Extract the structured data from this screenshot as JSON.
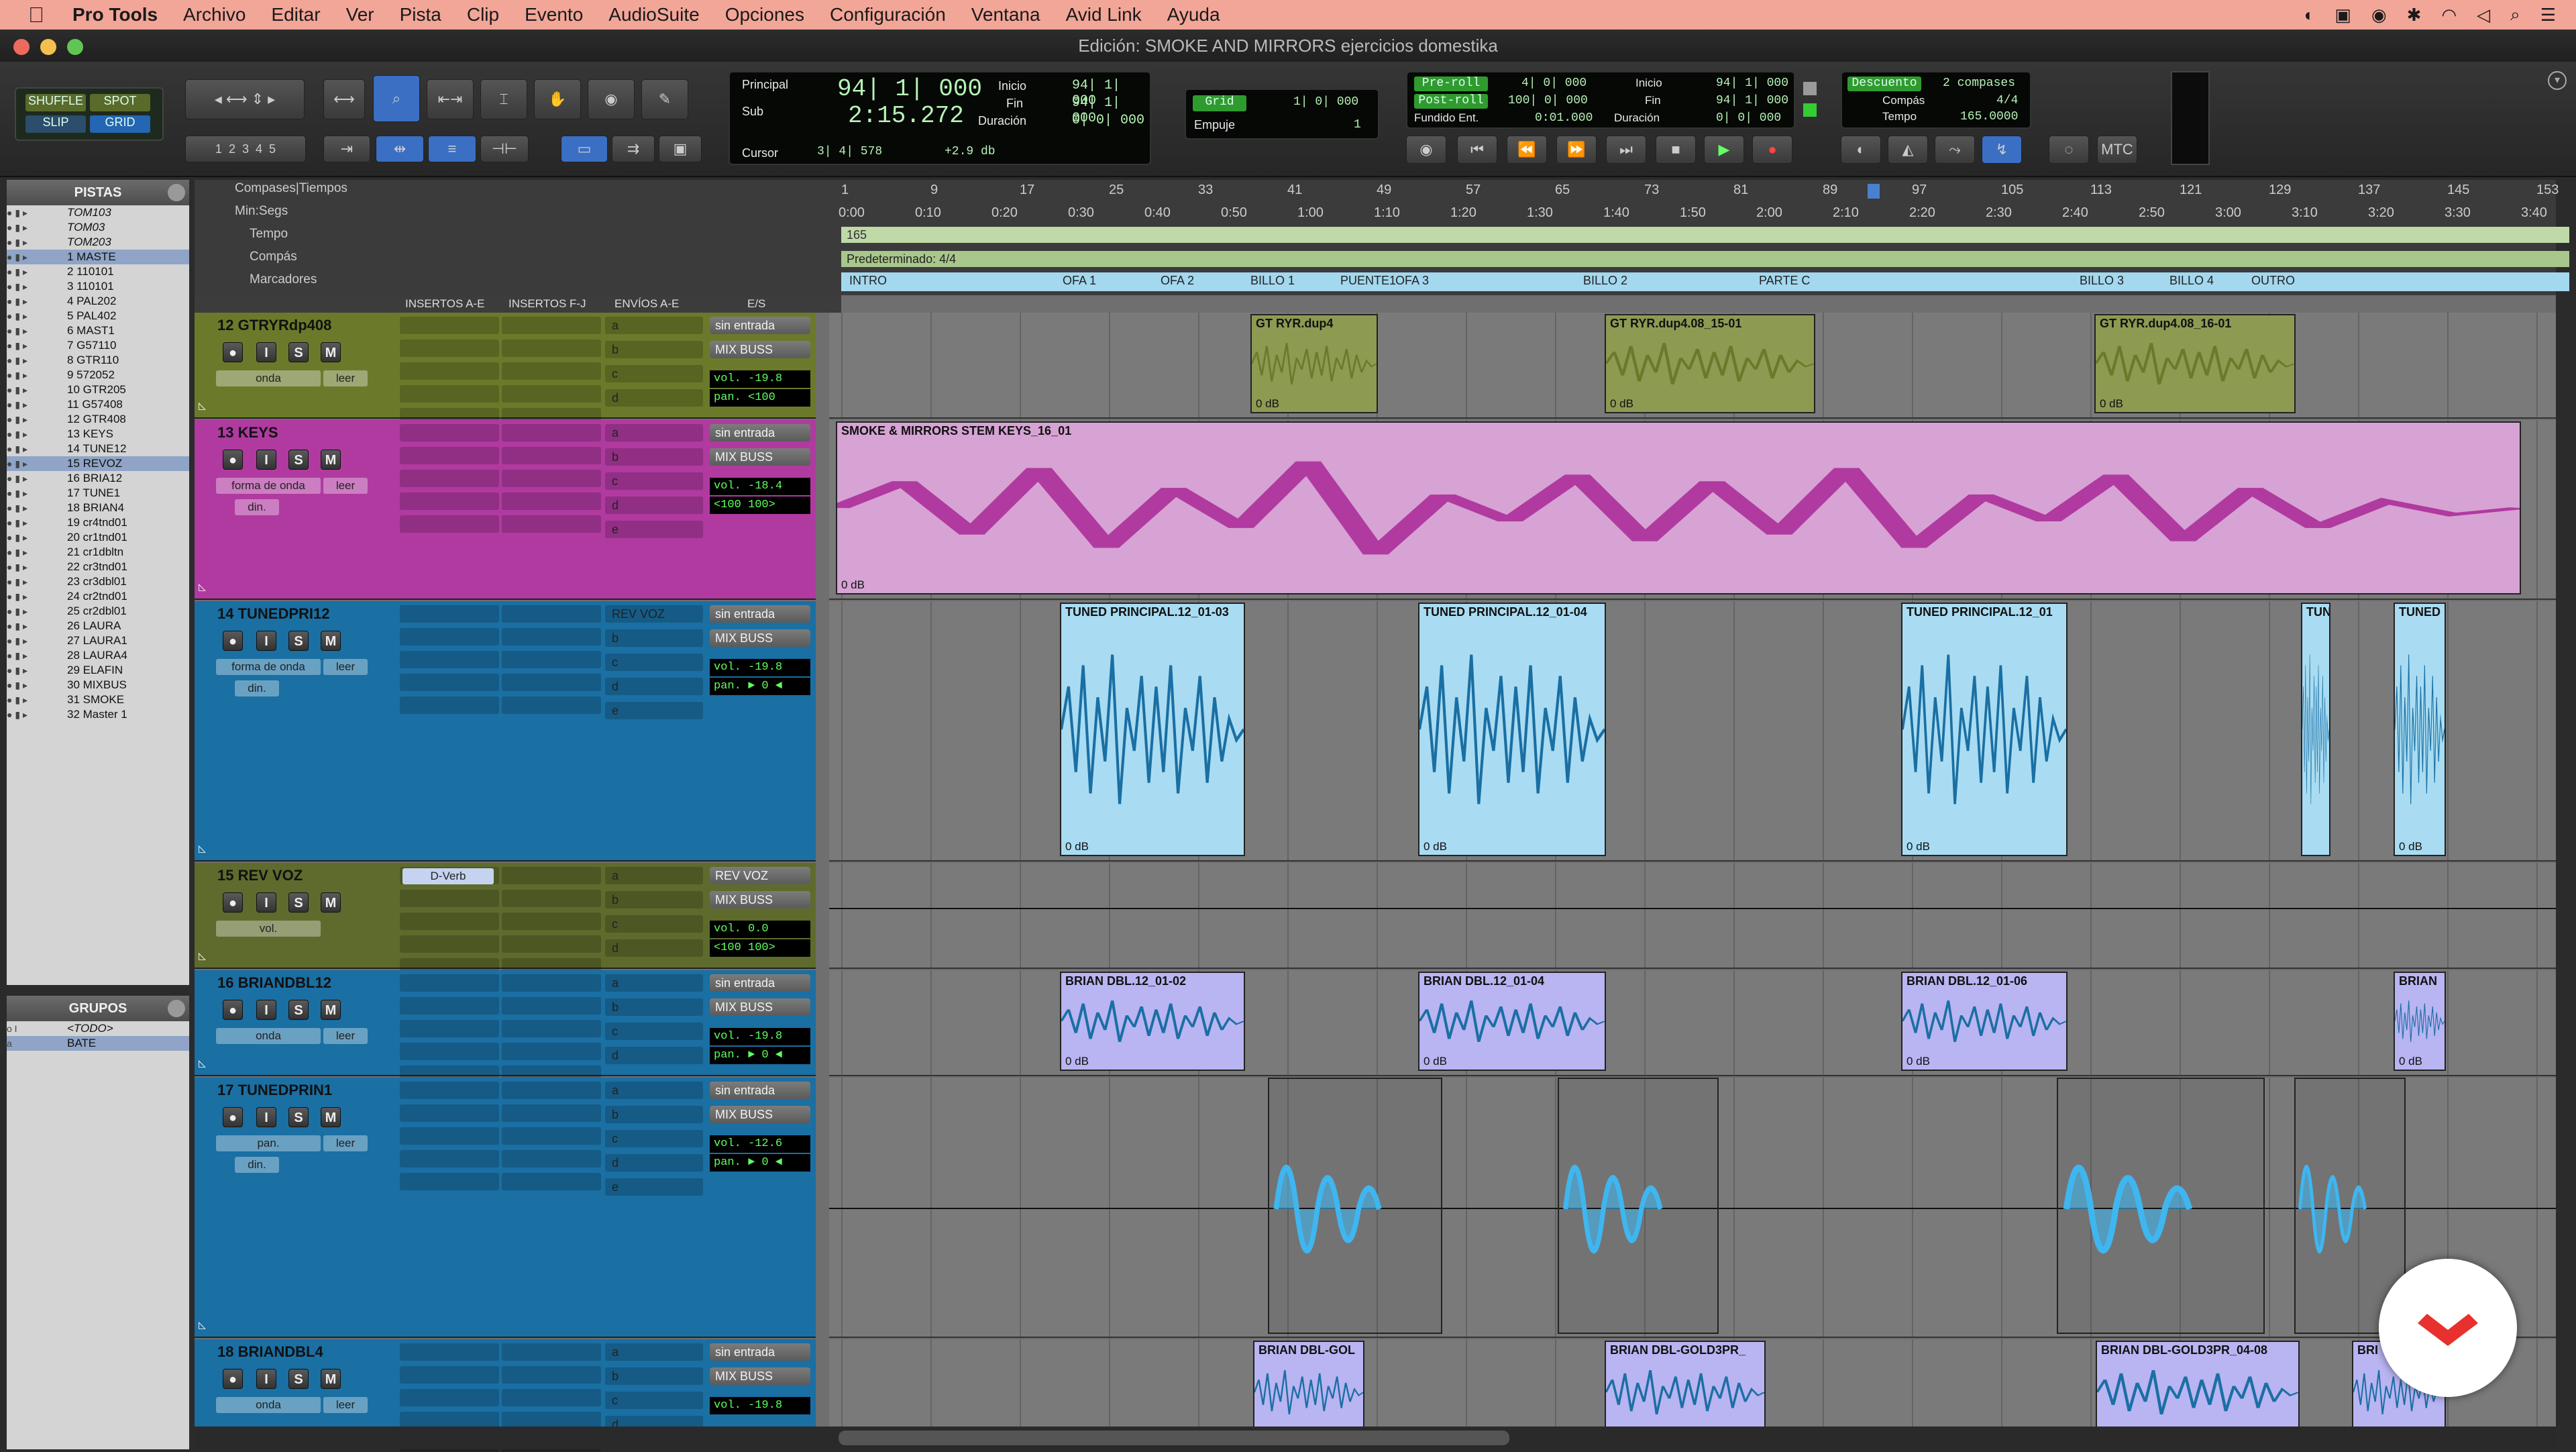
{
  "menubar": {
    "apple": "",
    "items": [
      "Pro Tools",
      "Archivo",
      "Editar",
      "Ver",
      "Pista",
      "Clip",
      "Evento",
      "AudioSuite",
      "Opciones",
      "Configuración",
      "Ventana",
      "Avid Link",
      "Ayuda"
    ]
  },
  "window": {
    "title": "Edición: SMOKE AND MIRRORS ejercicios domestika"
  },
  "toolbar": {
    "modes": {
      "shuffle": "SHUFFLE",
      "spot": "SPOT",
      "slip": "SLIP",
      "grid": "GRID"
    },
    "zoom_presets": [
      "1",
      "2",
      "3",
      "4",
      "5"
    ],
    "counter": {
      "principal_label": "Principal",
      "principal": "94| 1| 000",
      "sub_label": "Sub",
      "sub": "2:15.272",
      "cursor_label": "Cursor",
      "cursor": "3| 4| 578",
      "cursor_extra": "+2.9 db",
      "inicio_label": "Inicio",
      "inicio": "94| 1| 000",
      "fin_label": "Fin",
      "fin": "94| 1| 000",
      "duracion_label": "Duración",
      "duracion": "0| 0| 000"
    },
    "grid": {
      "label": "Grid",
      "value": "1| 0| 000",
      "nudge_label": "Empuje",
      "nudge": "1"
    },
    "transport": {
      "preroll_label": "Pre-roll",
      "preroll": "4| 0| 000",
      "postroll_label": "Post-roll",
      "postroll": "100| 0| 000",
      "fade_label": "Fundido Ent.",
      "fade": "0:01.000",
      "inicio_label": "Inicio",
      "inicio": "94| 1| 000",
      "fin_label": "Fin",
      "fin": "94| 1| 000",
      "duracion_label": "Duración",
      "duracion": "0| 0| 000"
    },
    "countoff": {
      "descuento": "Descuento",
      "compases": "2 compases",
      "compas_label": "Compás",
      "compas": "4/4",
      "tempo_label": "Tempo",
      "tempo": "165.0000"
    },
    "mtc": "MTC"
  },
  "tracks_panel": {
    "title": "PISTAS",
    "items": [
      {
        "label": "TOM103",
        "italic": true
      },
      {
        "label": "TOM03",
        "italic": true
      },
      {
        "label": "TOM203",
        "italic": true
      },
      {
        "label": "1  MASTE",
        "sel": true
      },
      {
        "label": "2  110101"
      },
      {
        "label": "3  110101"
      },
      {
        "label": "4  PAL202"
      },
      {
        "label": "5  PAL402"
      },
      {
        "label": "6  MAST1"
      },
      {
        "label": "7  G57110"
      },
      {
        "label": "8  GTR110"
      },
      {
        "label": "9  572052"
      },
      {
        "label": "10 GTR205"
      },
      {
        "label": "11 G57408"
      },
      {
        "label": "12 GTR408"
      },
      {
        "label": "13 KEYS"
      },
      {
        "label": "14 TUNE12"
      },
      {
        "label": "15 REVOZ",
        "sel": true
      },
      {
        "label": "16 BRIA12"
      },
      {
        "label": "17 TUNE1"
      },
      {
        "label": "18 BRIAN4"
      },
      {
        "label": "19 cr4tnd01"
      },
      {
        "label": "20 cr1tnd01"
      },
      {
        "label": "21 cr1dbltn"
      },
      {
        "label": "22 cr3tnd01"
      },
      {
        "label": "23 cr3dbl01"
      },
      {
        "label": "24 cr2tnd01"
      },
      {
        "label": "25 cr2dbl01"
      },
      {
        "label": "26 LAURA"
      },
      {
        "label": "27 LAURA1"
      },
      {
        "label": "28 LAURA4"
      },
      {
        "label": "29 ELAFIN"
      },
      {
        "label": "30 MIXBUS"
      },
      {
        "label": "31 SMOKE"
      },
      {
        "label": "32 Master 1"
      }
    ]
  },
  "groups_panel": {
    "title": "GRUPOS",
    "items": [
      "<TODO>",
      "BATE"
    ]
  },
  "rulers": {
    "labels": [
      "Compases|Tiempos",
      "Min:Segs",
      "Tempo",
      "Compás",
      "Marcadores"
    ],
    "bars": [
      "1",
      "9",
      "17",
      "25",
      "33",
      "41",
      "49",
      "57",
      "65",
      "73",
      "81",
      "89",
      "97",
      "105",
      "113",
      "121",
      "129",
      "137",
      "145",
      "153"
    ],
    "minsecs": [
      "0:00",
      "0:10",
      "0:20",
      "0:30",
      "0:40",
      "0:50",
      "1:00",
      "1:10",
      "1:20",
      "1:30",
      "1:40",
      "1:50",
      "2:00",
      "2:10",
      "2:20",
      "2:30",
      "2:40",
      "2:50",
      "3:00",
      "3:10",
      "3:20",
      "3:30",
      "3:40"
    ],
    "tempo": "165",
    "meter": "Predeterminado: 4/4",
    "markers": [
      "INTRO",
      "OFA 1",
      "OFA 2",
      "BILLO 1",
      "PUENTE1",
      "OFA 3",
      "BILLO 2",
      "PARTE C",
      "BILLO 3",
      "BILLO 4",
      "OUTRO"
    ]
  },
  "columns": {
    "inserts_ae": "INSERTOS A-E",
    "inserts_fj": "INSERTOS F-J",
    "sends": "ENVÍOS A-E",
    "io": "E/S"
  },
  "tracks": [
    {
      "name": "12 GTRYRdp408",
      "input": "sin entrada",
      "output": "MIX BUSS",
      "vol": "vol.   -19.8",
      "pan": "pan.   <100",
      "mode": "onda",
      "auto": "leer",
      "sends": [
        "a",
        "b",
        "c",
        "d"
      ],
      "clips": [
        {
          "title": "GT RYR.dup4",
          "gain": "0 dB"
        },
        {
          "title": "GT RYR.dup4.08_15-01",
          "gain": "0 dB"
        },
        {
          "title": "GT RYR.dup4.08_16-01",
          "gain": "0 dB"
        }
      ]
    },
    {
      "name": "13    KEYS",
      "input": "sin entrada",
      "output": "MIX BUSS",
      "vol": "vol.   -18.4",
      "pan": "<100  100>",
      "mode": "forma de onda",
      "auto": "leer",
      "dyn": "din.",
      "sends": [
        "a",
        "b",
        "c",
        "d",
        "e"
      ],
      "clips": [
        {
          "title": "SMOKE & MIRRORS STEM KEYS_16_01",
          "gain": "0 dB"
        }
      ]
    },
    {
      "name": "14 TUNEDPRI12",
      "input": "sin entrada",
      "output": "MIX BUSS",
      "vol": "vol.   -19.8",
      "pan": "pan.  ► 0 ◄",
      "mode": "forma de onda",
      "auto": "leer",
      "dyn": "din.",
      "sends": [
        "REV VOZ",
        "b",
        "c",
        "d",
        "e"
      ],
      "clips": [
        {
          "title": "TUNED PRINCIPAL.12_01-03",
          "gain": "0 dB"
        },
        {
          "title": "TUNED PRINCIPAL.12_01-04",
          "gain": "0 dB"
        },
        {
          "title": "TUNED PRINCIPAL.12_01",
          "gain": "0 dB"
        },
        {
          "title": "TUN",
          "gain": ""
        },
        {
          "title": "TUNED",
          "gain": "0 dB"
        }
      ]
    },
    {
      "name": "15    REV VOZ",
      "input": "REV VOZ",
      "output": "MIX BUSS",
      "vol": "vol.      0.0",
      "pan": "<100  100>",
      "mode": "vol.",
      "insert": "D-Verb",
      "sends": [
        "a",
        "b",
        "c",
        "d"
      ],
      "clips": []
    },
    {
      "name": "16 BRIANDBL12",
      "input": "sin entrada",
      "output": "MIX BUSS",
      "vol": "vol.   -19.8",
      "pan": "pan.  ► 0 ◄",
      "mode": "onda",
      "auto": "leer",
      "sends": [
        "a",
        "b",
        "c",
        "d"
      ],
      "clips": [
        {
          "title": "BRIAN DBL.12_01-02",
          "gain": "0 dB"
        },
        {
          "title": "BRIAN DBL.12_01-04",
          "gain": "0 dB"
        },
        {
          "title": "BRIAN DBL.12_01-06",
          "gain": "0 dB"
        },
        {
          "title": "BRIAN",
          "gain": "0 dB"
        }
      ]
    },
    {
      "name": "17 TUNEDPRIN1",
      "input": "sin entrada",
      "output": "MIX BUSS",
      "vol": "vol.   -12.6",
      "pan": "pan.  ► 0 ◄",
      "mode": "pan.",
      "auto": "leer",
      "dyn": "din.",
      "sends": [
        "a",
        "b",
        "c",
        "d",
        "e"
      ],
      "clips": []
    },
    {
      "name": "18 BRIANDBL4",
      "input": "sin entrada",
      "output": "MIX BUSS",
      "vol": "vol.   -19.8",
      "pan": "",
      "mode": "onda",
      "auto": "leer",
      "sends": [
        "a",
        "b",
        "c",
        "d"
      ],
      "clips": [
        {
          "title": "BRIAN DBL-GOL",
          "gain": ""
        },
        {
          "title": "BRIAN DBL-GOLD3PR_",
          "gain": ""
        },
        {
          "title": "BRIAN DBL-GOLD3PR_04-08",
          "gain": ""
        },
        {
          "title": "BRI",
          "gain": ""
        }
      ]
    }
  ],
  "colors": {
    "menubar": "#f2a698",
    "gtr": "#6b7a2a",
    "keys": "#b03aa0",
    "tuned": "#1a6fa3",
    "rev": "#5e6b2d",
    "brian": "#2b4fb5",
    "tunedclip": "#a9dcf2",
    "keysclip": "#d6a3d4",
    "brianclip": "#b9b4f2",
    "gtrclip": "#8d9a52",
    "markers": "#a3d8ef"
  }
}
